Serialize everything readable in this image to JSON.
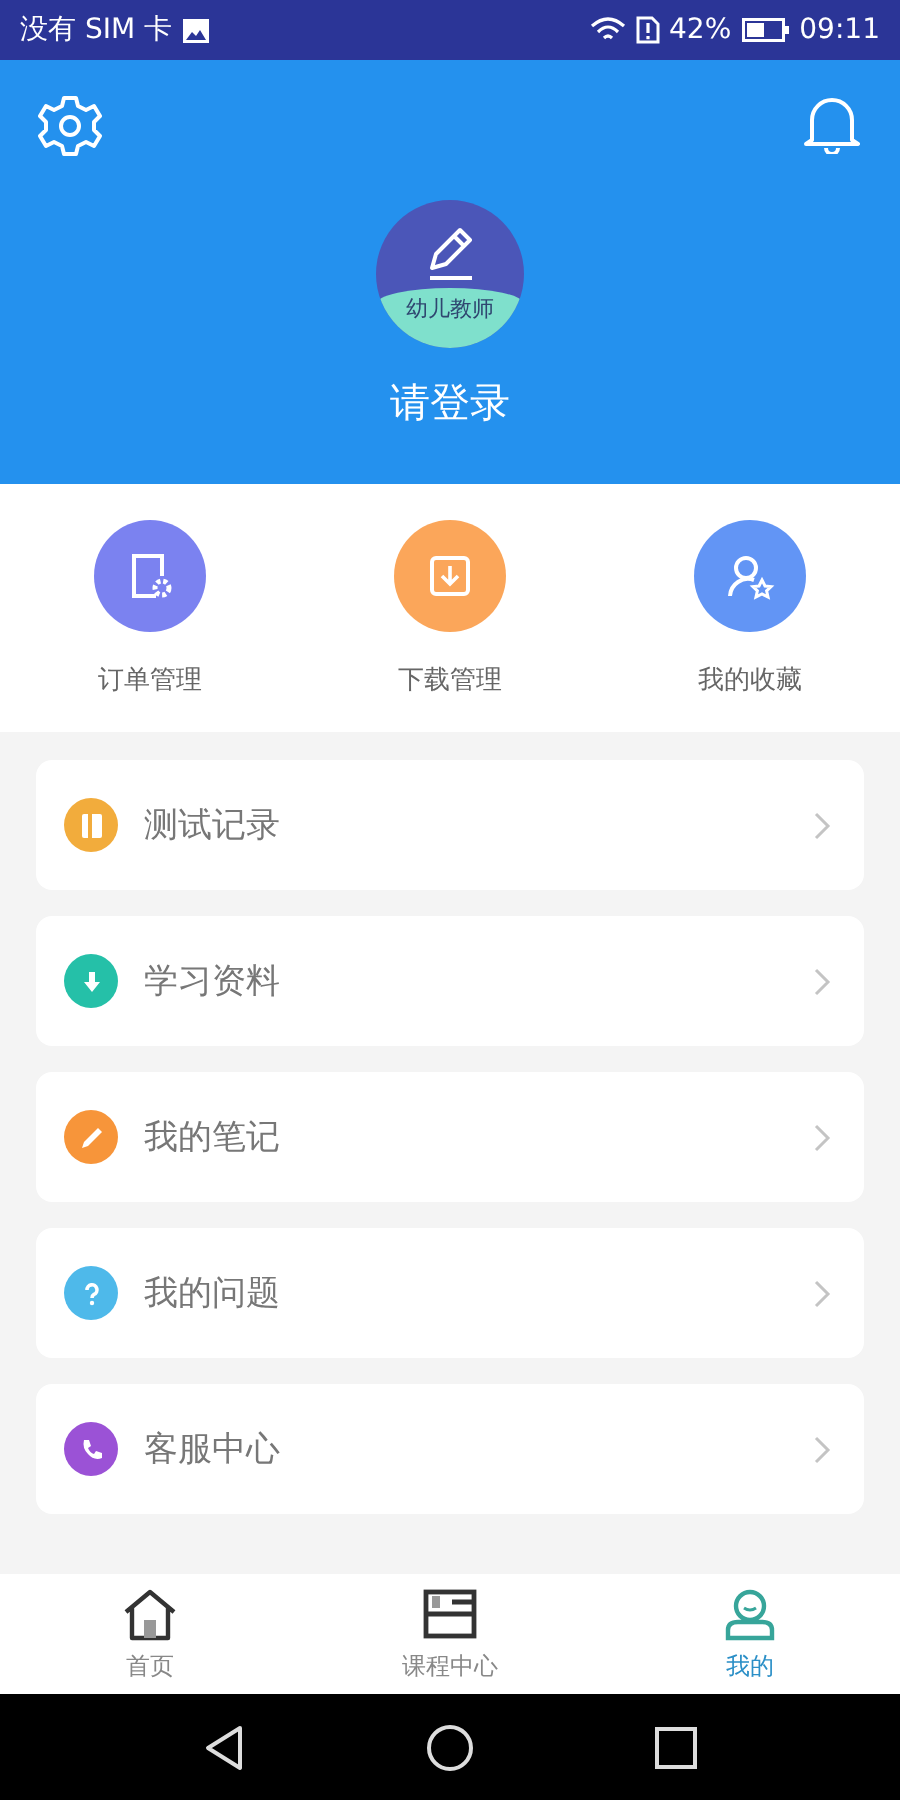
{
  "status_bar": {
    "carrier": "没有 SIM 卡",
    "battery": "42%",
    "time": "09:11"
  },
  "profile": {
    "badge": "幼儿教师",
    "login": "请登录"
  },
  "shortcuts": [
    {
      "label": "订单管理",
      "color": "#7b82f0"
    },
    {
      "label": "下载管理",
      "color": "#fba65a"
    },
    {
      "label": "我的收藏",
      "color": "#6295f5"
    }
  ],
  "menu": [
    {
      "label": "测试记录",
      "color": "#f2ac3c"
    },
    {
      "label": "学习资料",
      "color": "#25c0a8"
    },
    {
      "label": "我的笔记",
      "color": "#f7953a"
    },
    {
      "label": "我的问题",
      "color": "#4eb9ea"
    },
    {
      "label": "客服中心",
      "color": "#9b52d6"
    }
  ],
  "tabs": [
    {
      "label": "首页",
      "selected": false
    },
    {
      "label": "课程中心",
      "selected": false
    },
    {
      "label": "我的",
      "selected": true
    }
  ]
}
